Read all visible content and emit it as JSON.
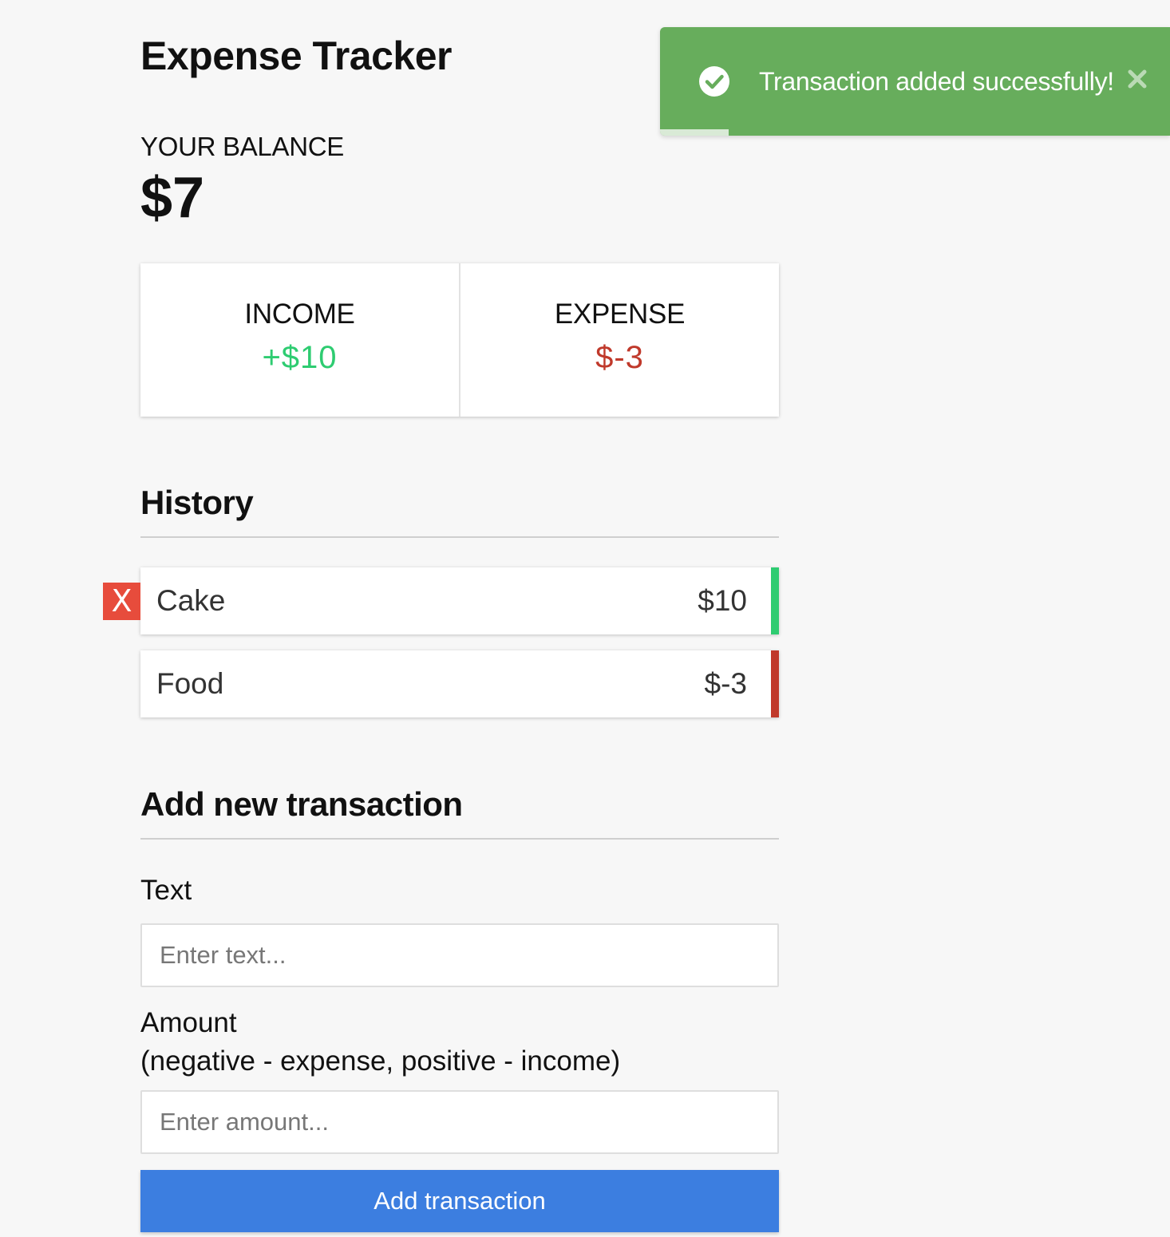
{
  "app": {
    "title": "Expense Tracker"
  },
  "balance": {
    "label": "YOUR BALANCE",
    "value": "$7"
  },
  "summary": {
    "income_label": "INCOME",
    "income_value": "+$10",
    "expense_label": "EXPENSE",
    "expense_value": "$-3"
  },
  "history": {
    "title": "History",
    "items": [
      {
        "text": "Cake",
        "amount": "$10",
        "type": "income",
        "delete_label": "X"
      },
      {
        "text": "Food",
        "amount": "$-3",
        "type": "expense"
      }
    ]
  },
  "form": {
    "title": "Add new transaction",
    "text_label": "Text",
    "text_placeholder": "Enter text...",
    "amount_label": "Amount",
    "amount_hint": "(negative - expense, positive - income)",
    "amount_placeholder": "Enter amount...",
    "submit_label": "Add transaction"
  },
  "toast": {
    "message": "Transaction added successfully!",
    "icon": "check-circle-icon",
    "close_icon": "close-icon",
    "progress": 0.135
  },
  "colors": {
    "income": "#2ecc71",
    "expense": "#c0392b",
    "delete": "#e74c3c",
    "primary_button": "#3c7ee0",
    "toast": "#67ad5c"
  }
}
